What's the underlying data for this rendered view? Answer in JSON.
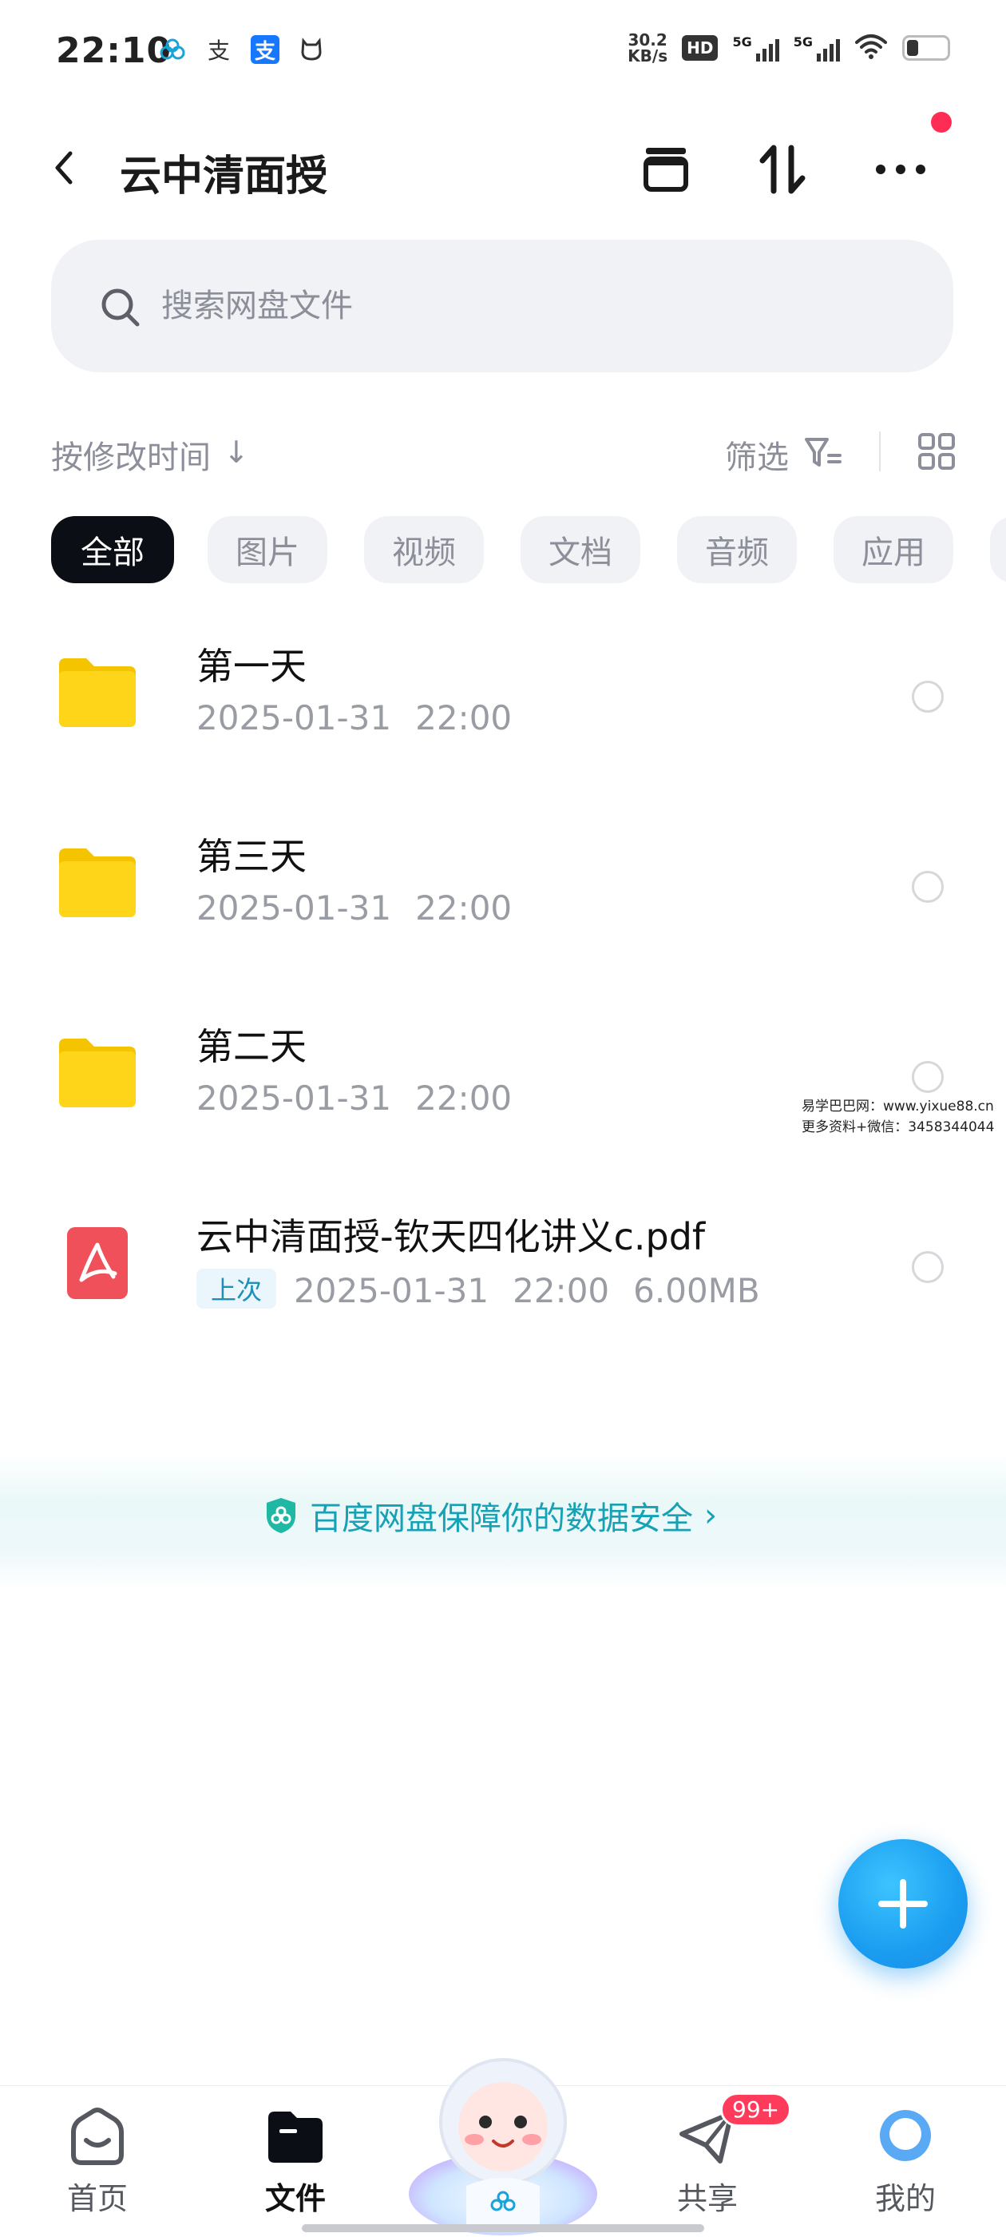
{
  "status_bar": {
    "time": "22:10",
    "net_speed_value": "30.2",
    "net_speed_unit": "KB/s",
    "hd_label": "HD",
    "signal1_label": "5G",
    "signal2_label": "5G",
    "app_icons": [
      "baidu-netdisk-icon",
      "alipay-outline-icon",
      "alipay-icon",
      "cat-icon"
    ]
  },
  "header": {
    "title": "云中清面授",
    "actions": [
      "archive-icon",
      "transfer-icon",
      "more-icon"
    ]
  },
  "search": {
    "placeholder": "搜索网盘文件"
  },
  "sort": {
    "label": "按修改时间",
    "arrow": "↓",
    "filter_label": "筛选"
  },
  "chips": [
    {
      "label": "全部",
      "active": true
    },
    {
      "label": "图片",
      "active": false
    },
    {
      "label": "视频",
      "active": false
    },
    {
      "label": "文档",
      "active": false
    },
    {
      "label": "音频",
      "active": false
    },
    {
      "label": "应用",
      "active": false
    }
  ],
  "files": [
    {
      "name": "第一天",
      "type": "folder",
      "date": "2025-01-31",
      "time": "22:00"
    },
    {
      "name": "第三天",
      "type": "folder",
      "date": "2025-01-31",
      "time": "22:00"
    },
    {
      "name": "第二天",
      "type": "folder",
      "date": "2025-01-31",
      "time": "22:00"
    },
    {
      "name": "云中清面授-钦天四化讲义c.pdf",
      "type": "pdf",
      "tag": "上次",
      "date": "2025-01-31",
      "time": "22:00",
      "size": "6.00MB"
    }
  ],
  "watermark": {
    "line1": "易学巴巴网：www.yixue88.cn",
    "line2": "更多资料+微信：3458344044"
  },
  "banner": {
    "text": "百度网盘保障你的数据安全",
    "chevron": "›"
  },
  "nav": {
    "home": "首页",
    "files": "文件",
    "share": "共享",
    "share_badge": "99+",
    "mine": "我的"
  },
  "colors": {
    "accent": "#1a9df0",
    "banner_text": "#16a1b5",
    "folder": "#ffd51a",
    "pdf": "#f0505a",
    "badge": "#ff3b5c",
    "active_chip": "#0b0e14"
  }
}
